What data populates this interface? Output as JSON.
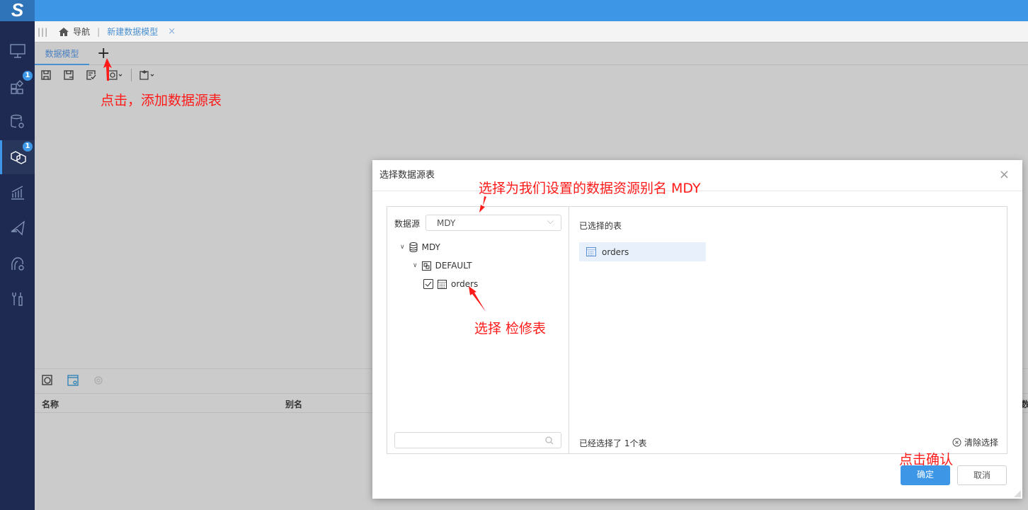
{
  "app": {
    "logo": "S"
  },
  "sidebar": {
    "items": [
      {
        "icon": "monitor-icon"
      },
      {
        "icon": "dashboard-icon",
        "badge": "1"
      },
      {
        "icon": "database-settings-icon"
      },
      {
        "icon": "cubes-icon",
        "badge": "1",
        "active": true
      },
      {
        "icon": "chart-icon"
      },
      {
        "icon": "paper-plane-icon"
      },
      {
        "icon": "support-icon"
      },
      {
        "icon": "tools-icon"
      }
    ]
  },
  "nav": {
    "home_label": "导航",
    "tab_label": "新建数据模型"
  },
  "tabs": {
    "data_model": "数据模型",
    "add": "+"
  },
  "bottom": {
    "columns": [
      "名称",
      "别名"
    ],
    "cut_column": "数"
  },
  "annotations": {
    "add_table": "点击，添加数据源表",
    "choose_source": "选择为我们设置的数据资源别名 MDY",
    "choose_table": "选择 检修表",
    "confirm": "点击确认"
  },
  "dialog": {
    "title": "选择数据源表",
    "source_label": "数据源",
    "source_value": "MDY",
    "tree": {
      "db": "MDY",
      "schema": "DEFAULT",
      "table": "orders",
      "checked": true
    },
    "search_placeholder": "",
    "selected_title": "已选择的表",
    "selected": [
      "orders"
    ],
    "count_text": "已经选择了 1个表",
    "clear": "清除选择",
    "ok": "确定",
    "cancel": "取消"
  }
}
